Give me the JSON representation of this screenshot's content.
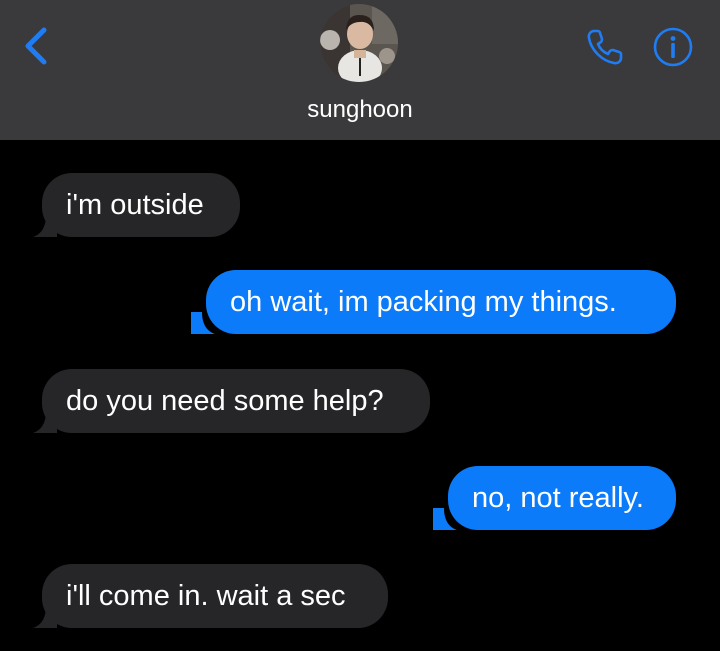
{
  "header": {
    "contact_name": "sunghoon",
    "back_icon": "chevron-left-icon",
    "call_icon": "phone-icon",
    "info_icon": "info-icon",
    "accent_color": "#1f7cf2",
    "bar_color": "#3a3a3c"
  },
  "messages": [
    {
      "sender": "contact",
      "text": "i'm outside"
    },
    {
      "sender": "me",
      "text": "oh wait, im packing my things."
    },
    {
      "sender": "contact",
      "text": "do you need some help?"
    },
    {
      "sender": "me",
      "text": "no, not really."
    },
    {
      "sender": "contact",
      "text": "i'll come in. wait a sec"
    }
  ],
  "colors": {
    "received_bubble": "#262629",
    "sent_bubble": "#0b7bfa",
    "background": "#000000",
    "text": "#ffffff"
  }
}
